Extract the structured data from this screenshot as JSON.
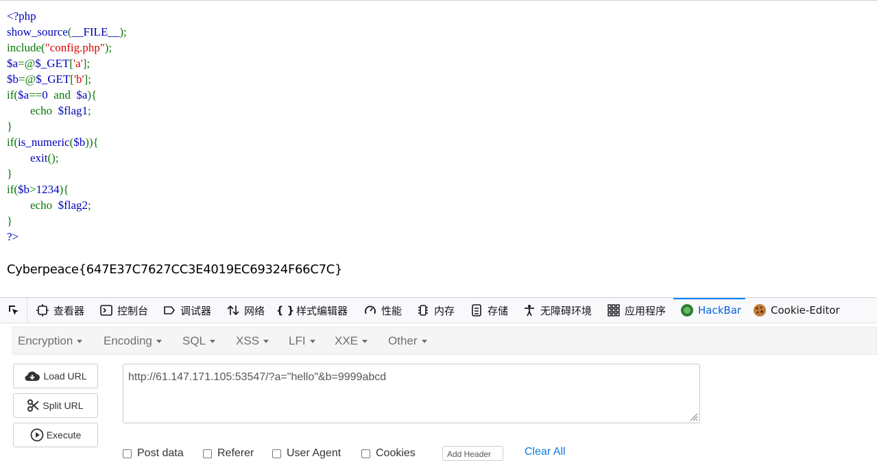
{
  "source": {
    "lines": [
      [
        {
          "t": "<?php",
          "c": "d"
        }
      ],
      [
        {
          "t": "show_source",
          "c": "d"
        },
        {
          "t": "(",
          "c": "k"
        },
        {
          "t": "__FILE__",
          "c": "d"
        },
        {
          "t": ");",
          "c": "k"
        }
      ],
      [
        {
          "t": "include(",
          "c": "k"
        },
        {
          "t": "\"config.php\"",
          "c": "s"
        },
        {
          "t": ");",
          "c": "k"
        }
      ],
      [
        {
          "t": "$a",
          "c": "d"
        },
        {
          "t": "=@",
          "c": "k"
        },
        {
          "t": "$_GET",
          "c": "d"
        },
        {
          "t": "[",
          "c": "k"
        },
        {
          "t": "'a'",
          "c": "s"
        },
        {
          "t": "];",
          "c": "k"
        }
      ],
      [
        {
          "t": "$b",
          "c": "d"
        },
        {
          "t": "=@",
          "c": "k"
        },
        {
          "t": "$_GET",
          "c": "d"
        },
        {
          "t": "[",
          "c": "k"
        },
        {
          "t": "'b'",
          "c": "s"
        },
        {
          "t": "];",
          "c": "k"
        }
      ],
      [
        {
          "t": "if(",
          "c": "k"
        },
        {
          "t": "$a",
          "c": "d"
        },
        {
          "t": "==",
          "c": "k"
        },
        {
          "t": "0  ",
          "c": "d"
        },
        {
          "t": "and  ",
          "c": "k"
        },
        {
          "t": "$a",
          "c": "d"
        },
        {
          "t": "){",
          "c": "k"
        }
      ],
      [
        {
          "t": "        echo  ",
          "c": "k"
        },
        {
          "t": "$flag1",
          "c": "d"
        },
        {
          "t": ";",
          "c": "k"
        }
      ],
      [
        {
          "t": "}",
          "c": "k"
        }
      ],
      [
        {
          "t": "if(",
          "c": "k"
        },
        {
          "t": "is_numeric",
          "c": "d"
        },
        {
          "t": "(",
          "c": "k"
        },
        {
          "t": "$b",
          "c": "d"
        },
        {
          "t": ")){",
          "c": "k"
        }
      ],
      [
        {
          "t": "        exit",
          "c": "d"
        },
        {
          "t": "();",
          "c": "k"
        }
      ],
      [
        {
          "t": "}",
          "c": "k"
        }
      ],
      [
        {
          "t": "if(",
          "c": "k"
        },
        {
          "t": "$b",
          "c": "d"
        },
        {
          "t": ">",
          "c": "k"
        },
        {
          "t": "1234",
          "c": "d"
        },
        {
          "t": "){",
          "c": "k"
        }
      ],
      [
        {
          "t": "        echo  ",
          "c": "k"
        },
        {
          "t": "$flag2",
          "c": "d"
        },
        {
          "t": ";",
          "c": "k"
        }
      ],
      [
        {
          "t": "}",
          "c": "k"
        }
      ],
      [
        {
          "t": "?>",
          "c": "d"
        }
      ]
    ]
  },
  "flag": "Cyberpeace{647E37C7627CC3E4019EC69324F66C7C}",
  "devtools": {
    "tabs": [
      {
        "label": "查看器",
        "icon": "inspector-icon"
      },
      {
        "label": "控制台",
        "icon": "console-icon"
      },
      {
        "label": "调试器",
        "icon": "debugger-icon"
      },
      {
        "label": "网络",
        "icon": "network-icon"
      },
      {
        "label": "样式编辑器",
        "icon": "style-editor-icon"
      },
      {
        "label": "性能",
        "icon": "performance-icon"
      },
      {
        "label": "内存",
        "icon": "memory-icon"
      },
      {
        "label": "存储",
        "icon": "storage-icon"
      },
      {
        "label": "无障碍环境",
        "icon": "accessibility-icon"
      },
      {
        "label": "应用程序",
        "icon": "application-icon"
      },
      {
        "label": "HackBar",
        "icon": "hackbar-icon",
        "active": true
      },
      {
        "label": "Cookie-Editor",
        "icon": "cookie-icon"
      }
    ]
  },
  "hackbar": {
    "menu": [
      "Encryption",
      "Encoding",
      "SQL",
      "XSS",
      "LFI",
      "XXE",
      "Other"
    ],
    "load_url": "Load URL",
    "split_url": "Split URL",
    "execute": "Execute",
    "url": "http://61.147.171.105:53547/?a=\"hello\"&b=9999abcd",
    "options": [
      "Post data",
      "Referer",
      "User Agent",
      "Cookies"
    ],
    "add_header": "Add Header",
    "clear_all": "Clear All"
  },
  "colors": {
    "keyword": "#007700",
    "string": "#dd0000",
    "default": "#0000bb",
    "active_tab": "#0061e0",
    "link": "#0a7bdc"
  }
}
